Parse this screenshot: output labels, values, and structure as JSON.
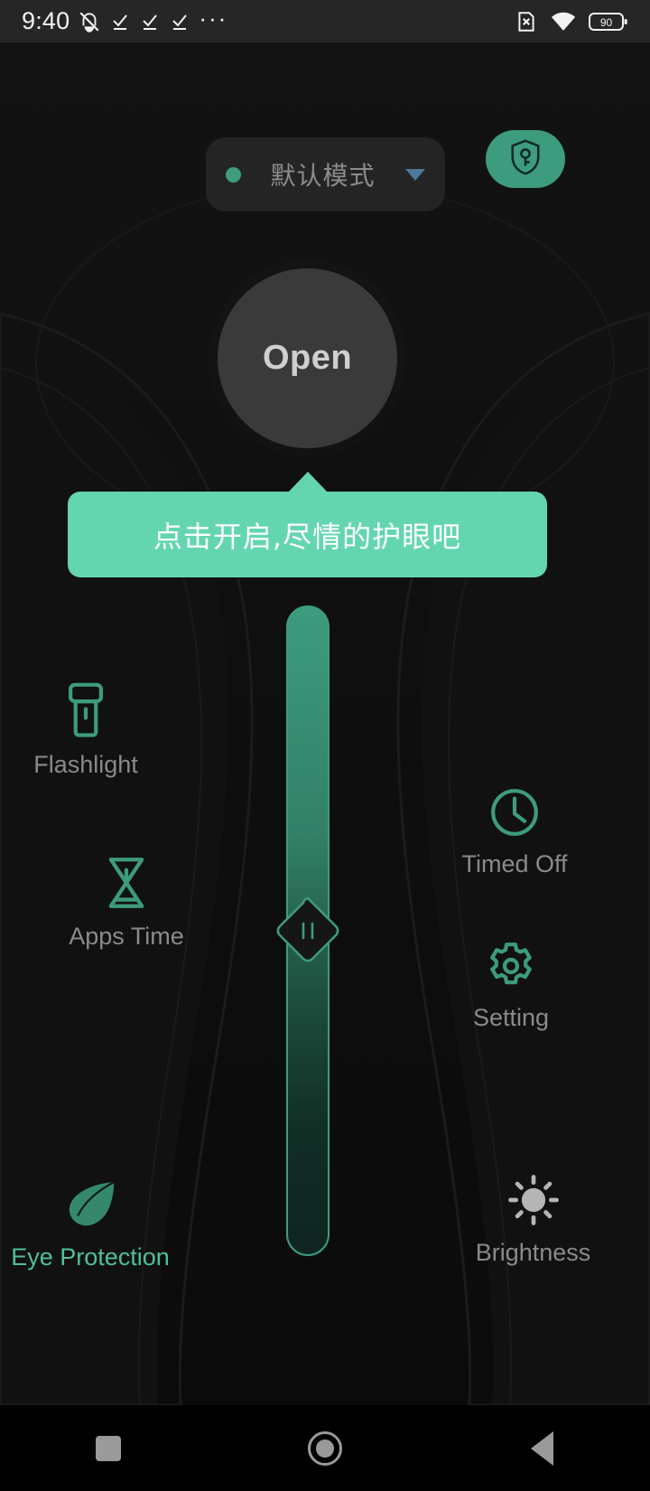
{
  "status_bar": {
    "time": "9:40",
    "left_icons": [
      "mute-bell-icon",
      "check-underline-icon",
      "check-underline-icon",
      "check-underline-icon"
    ],
    "overflow": "···",
    "right_icons": [
      "sim-card-off-icon",
      "wifi-icon"
    ],
    "battery_level": "90"
  },
  "topbar": {
    "mode_label": "默认模式",
    "mode_indicator_color": "#3f9c7e",
    "caret_icon": "chevron-down-icon",
    "caret_color": "#4d7899",
    "shield_icon": "shield-key-icon",
    "shield_color": "#3d9b7e"
  },
  "power": {
    "label": "Open",
    "circle_color": "#3a3a3a",
    "text_color": "#cfcfcf"
  },
  "tooltip": {
    "text": "点击开启,尽情的护眼吧",
    "background": "#63d6b0",
    "text_color": "#ffffff"
  },
  "slider": {
    "accent": "#3d9b7e",
    "knob_icon": "pause-handle-icon",
    "orientation": "vertical"
  },
  "features": {
    "flashlight": {
      "label": "Flashlight",
      "icon": "flashlight-icon",
      "color": "#3d9b7e",
      "active": false
    },
    "apps_time": {
      "label": "Apps Time",
      "icon": "hourglass-icon",
      "color": "#3d9b7e",
      "active": false
    },
    "eye_protection": {
      "label": "Eye Protection",
      "icon": "leaf-icon",
      "color": "#3d9b7e",
      "active": true
    },
    "timed_off": {
      "label": "Timed Off",
      "icon": "clock-icon",
      "color": "#3d9b7e",
      "active": false
    },
    "setting": {
      "label": "Setting",
      "icon": "gear-icon",
      "color": "#3d9b7e",
      "active": false
    },
    "brightness": {
      "label": "Brightness",
      "icon": "sun-icon",
      "color": "#b0b0b0",
      "active": false
    }
  },
  "navbar": {
    "recents": "recents-square-icon",
    "home": "home-circle-icon",
    "back": "back-triangle-icon"
  }
}
